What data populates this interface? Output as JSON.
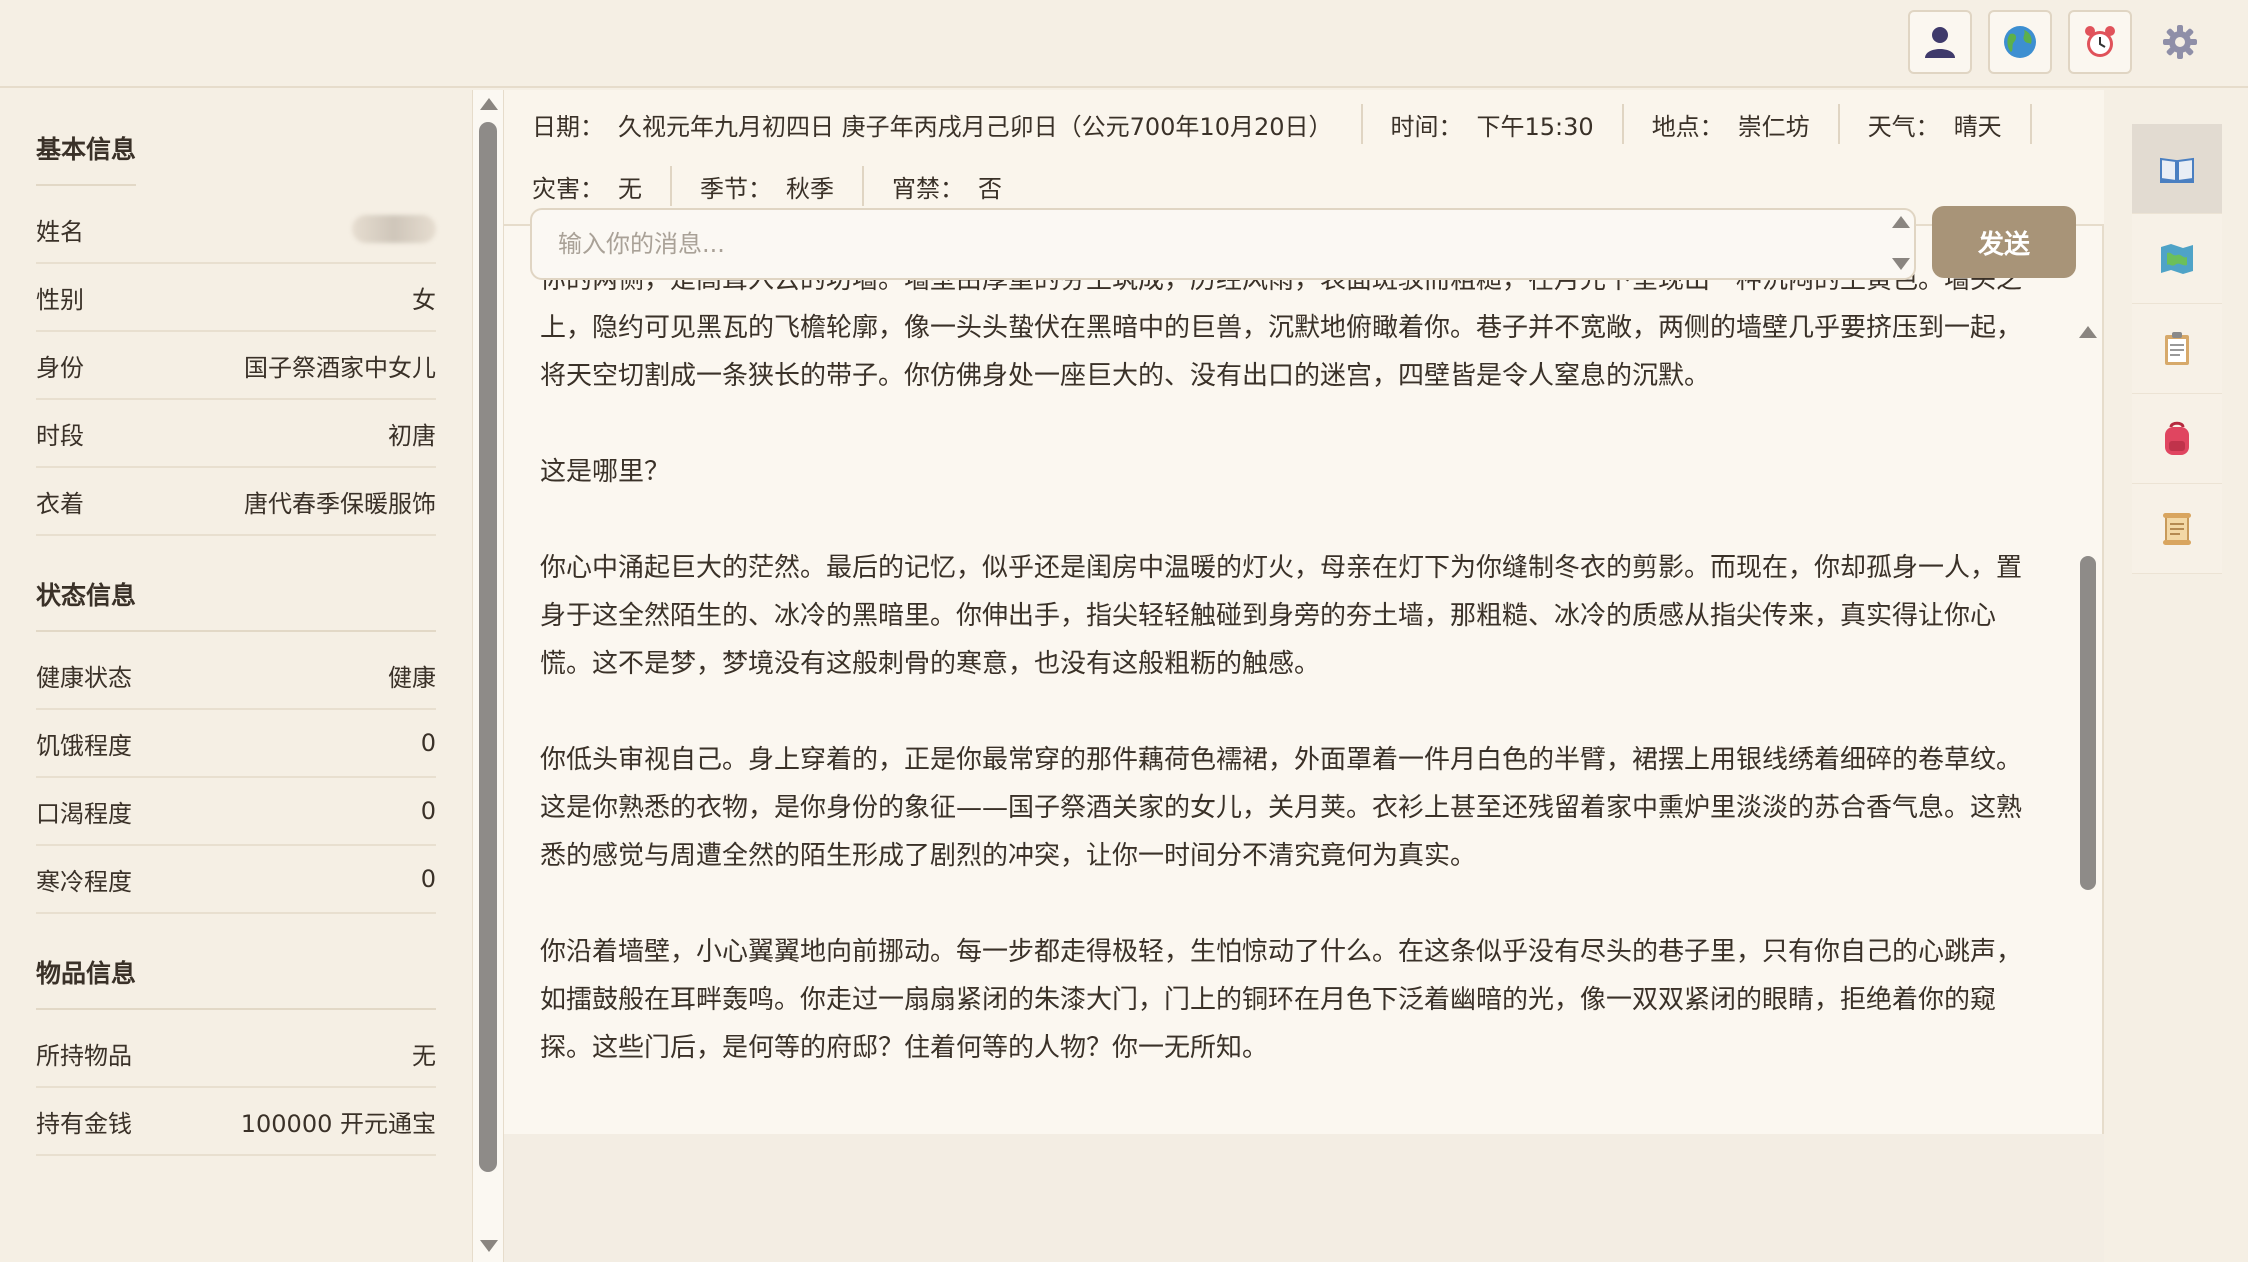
{
  "topbar": {
    "icons": [
      "user-icon",
      "globe-icon",
      "alarm-clock-icon",
      "gear-icon"
    ]
  },
  "sidebar": {
    "basic": {
      "title": "基本信息",
      "rows": [
        {
          "label": "姓名",
          "value": ""
        },
        {
          "label": "性别",
          "value": "女"
        },
        {
          "label": "身份",
          "value": "国子祭酒家中女儿"
        },
        {
          "label": "时段",
          "value": "初唐"
        },
        {
          "label": "衣着",
          "value": "唐代春季保暖服饰"
        }
      ]
    },
    "status": {
      "title": "状态信息",
      "rows": [
        {
          "label": "健康状态",
          "value": "健康"
        },
        {
          "label": "饥饿程度",
          "value": "0"
        },
        {
          "label": "口渴程度",
          "value": "0"
        },
        {
          "label": "寒冷程度",
          "value": "0"
        }
      ]
    },
    "items": {
      "title": "物品信息",
      "rows": [
        {
          "label": "所持物品",
          "value": "无"
        },
        {
          "label": "持有金钱",
          "value": "100000 开元通宝"
        }
      ]
    }
  },
  "info": {
    "date_label": "日期：",
    "date_value": "久视元年九月初四日 庚子年丙戌月己卯日（公元700年10月20日）",
    "time_label": "时间：",
    "time_value": "下午15:30",
    "place_label": "地点：",
    "place_value": "崇仁坊",
    "weather_label": "天气：",
    "weather_value": "晴天",
    "disaster_label": "灾害：",
    "disaster_value": "无",
    "season_label": "季节：",
    "season_value": "秋季",
    "curfew_label": "宵禁：",
    "curfew_value": "否"
  },
  "story": {
    "paragraphs": [
      "你的两侧，是高耸入云的坊墙。墙壁由厚重的夯土筑成，历经风雨，表面斑驳而粗糙，在月光下呈现出一种沉闷的土黄色。墙头之上，隐约可见黑瓦的飞檐轮廓，像一头头蛰伏在黑暗中的巨兽，沉默地俯瞰着你。巷子并不宽敞，两侧的墙壁几乎要挤压到一起，将天空切割成一条狭长的带子。你仿佛身处一座巨大的、没有出口的迷宫，四壁皆是令人窒息的沉默。",
      "这是哪里？",
      "你心中涌起巨大的茫然。最后的记忆，似乎还是闺房中温暖的灯火，母亲在灯下为你缝制冬衣的剪影。而现在，你却孤身一人，置身于这全然陌生的、冰冷的黑暗里。你伸出手，指尖轻轻触碰到身旁的夯土墙，那粗糙、冰冷的质感从指尖传来，真实得让你心慌。这不是梦，梦境没有这般刺骨的寒意，也没有这般粗粝的触感。",
      "你低头审视自己。身上穿着的，正是你最常穿的那件藕荷色襦裙，外面罩着一件月白色的半臂，裙摆上用银线绣着细碎的卷草纹。这是你熟悉的衣物，是你身份的象征——国子祭酒关家的女儿，关月荚。衣衫上甚至还残留着家中熏炉里淡淡的苏合香气息。这熟悉的感觉与周遭全然的陌生形成了剧烈的冲突，让你一时间分不清究竟何为真实。",
      "你沿着墙壁，小心翼翼地向前挪动。每一步都走得极轻，生怕惊动了什么。在这条似乎没有尽头的巷子里，只有你自己的心跳声，如擂鼓般在耳畔轰鸣。你走过一扇扇紧闭的朱漆大门，门上的铜环在月色下泛着幽暗的光，像一双双紧闭的眼睛，拒绝着你的窥探。这些门后，是何等的府邸？住着何等的人物？你一无所知。"
    ]
  },
  "composer": {
    "placeholder": "输入你的消息...",
    "send_label": "发送"
  },
  "rail": {
    "icons": [
      "open-book-icon",
      "map-icon",
      "clipboard-icon",
      "backpack-icon",
      "scroll-icon"
    ]
  },
  "colors": {
    "background": "#f5efe4",
    "panel": "#fbf7f0",
    "send_button": "#a89478",
    "text": "#3a3128"
  }
}
